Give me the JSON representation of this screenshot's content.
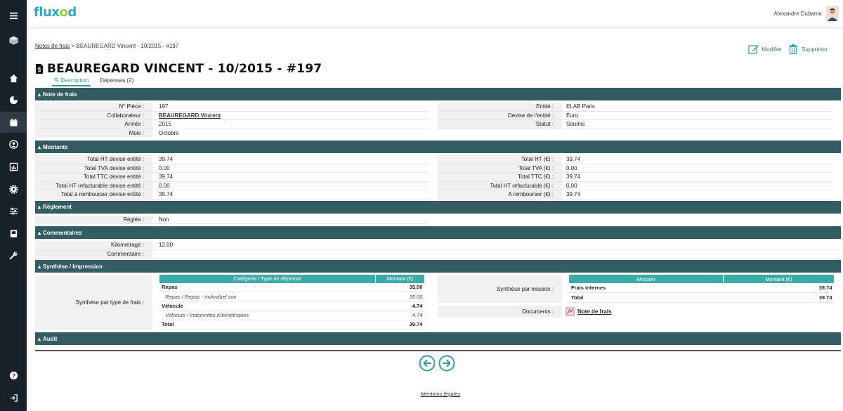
{
  "app": {
    "logo_part1": "flux",
    "logo_part2": "o",
    "logo_part3": "d",
    "user_name": "Alexandre Dubame"
  },
  "colors": {
    "sidebar": "#1b2128",
    "section": "#325c62",
    "table_header": "#3eaaa8",
    "accent": "#3b8f98"
  },
  "sidebar": {
    "icons": [
      "menu-icon",
      "cube-icon",
      "home-icon",
      "pie-chart-icon",
      "calendar-icon",
      "user-circle-icon",
      "chart-icon",
      "gear-icon",
      "sliders-icon",
      "book-icon",
      "wrench-icon",
      "help-icon",
      "logout-icon"
    ]
  },
  "breadcrumb": {
    "link": "Notes de frais",
    "separator": " > ",
    "current": "BEAUREGARD Vincent - 10/2015 - #197"
  },
  "actions": {
    "edit": "Modifier",
    "delete": "Supprimer"
  },
  "page": {
    "title": "BEAUREGARD VINCENT - 10/2015 - #197"
  },
  "tabs": {
    "description": "Description",
    "expenses": "Dépenses (2)"
  },
  "sections": {
    "note": {
      "title": "Note de frais",
      "left": [
        {
          "label": "N° Pièce :",
          "value": "197"
        },
        {
          "label": "Collaborateur :",
          "value": "BEAUREGARD Vincent"
        },
        {
          "label": "Année :",
          "value": "2015"
        },
        {
          "label": "Mois :",
          "value": "Octobre"
        }
      ],
      "right": [
        {
          "label": "Entité :",
          "value": "ELAB Paris"
        },
        {
          "label": "Devise de l'entité :",
          "value": "Euro"
        },
        {
          "label": "Statut :",
          "value": "Soumis"
        }
      ]
    },
    "amounts": {
      "title": "Montants",
      "left": [
        {
          "label": "Total HT devise entité :",
          "value": "39.74"
        },
        {
          "label": "Total TVA devise entité :",
          "value": "0.00"
        },
        {
          "label": "Total TTC devise entité :",
          "value": "39.74"
        },
        {
          "label": "Total HT refacturable devise entité :",
          "value": "0.00"
        },
        {
          "label": "Total à rembourser devise entité :",
          "value": "39.74"
        }
      ],
      "right": [
        {
          "label": "Total HT (€) :",
          "value": "39.74"
        },
        {
          "label": "Total TVA (€) :",
          "value": "0.00"
        },
        {
          "label": "Total TTC (€) :",
          "value": "39.74"
        },
        {
          "label": "Total HT refacturable (€) :",
          "value": "0.00"
        },
        {
          "label": "A rembourser (€) :",
          "value": "39.74"
        }
      ]
    },
    "settlement": {
      "title": "Règlement",
      "label": "Réglée :",
      "value": "Non"
    },
    "comments": {
      "title": "Commentaires",
      "rows": [
        {
          "label": "Kilometrage :",
          "value": "12.00"
        },
        {
          "label": "Commentaire :",
          "value": ""
        }
      ]
    },
    "synthesis": {
      "title": "Synthèse / Impression",
      "left_label": "Synthèse par type de frais :",
      "left_headers": [
        "Catégorie / Type de dépense",
        "Montant (€)"
      ],
      "left_rows": [
        {
          "name": "Repas",
          "amount": "35.00",
          "kind": "bold"
        },
        {
          "name": "Repas / Repas - individuel soir",
          "amount": "35.00",
          "kind": "sub"
        },
        {
          "name": "Véhicule",
          "amount": "4.74",
          "kind": "bold"
        },
        {
          "name": "Véhicule / Indemnités Kilométriques",
          "amount": "4.74",
          "kind": "sub"
        },
        {
          "name": "Total",
          "amount": "39.74",
          "kind": "bold"
        }
      ],
      "right_label": "Synthèse par mission :",
      "right_headers": [
        "Mission",
        "Montant (€)"
      ],
      "right_rows": [
        {
          "name": "Frais internes",
          "amount": "39.74",
          "kind": "bold"
        },
        {
          "name": "Total",
          "amount": "39.74",
          "kind": "bold"
        }
      ],
      "documents_label": "Documents :",
      "document_link": "Note de frais"
    },
    "audit": {
      "title": "Audit"
    }
  },
  "footer": {
    "legal": "Mentions légales"
  }
}
